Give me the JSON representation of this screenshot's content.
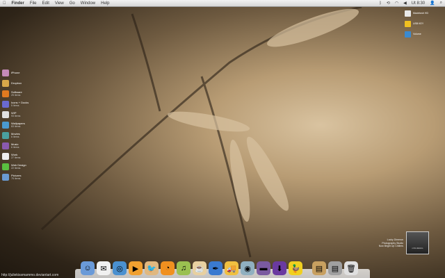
{
  "menubar": {
    "apple": "",
    "app": "Finder",
    "items": [
      "File",
      "Edit",
      "View",
      "Go",
      "Window",
      "Help"
    ],
    "status_icons": [
      "bluetooth-icon",
      "timemachine-icon",
      "wifi-icon",
      "volume-icon"
    ],
    "clock": "Ut 8:30"
  },
  "sidebar": [
    {
      "name": "iPhone",
      "count": "",
      "color": "#c48ab8"
    },
    {
      "name": "Dropbox",
      "count": "",
      "color": "#d9a84a"
    },
    {
      "name": "Software",
      "count": "25 Items",
      "color": "#e07a20"
    },
    {
      "name": "Icons + Docks",
      "count": "5 Items",
      "color": "#6a6ad0"
    },
    {
      "name": "WIP",
      "count": "93 Items",
      "color": "#e0e0e0"
    },
    {
      "name": "Wallpapers",
      "count": "83 Items",
      "color": "#4a9ad0"
    },
    {
      "name": "Movies",
      "count": "6 Items",
      "color": "#4aa0a0"
    },
    {
      "name": "Music",
      "count": "6 Items",
      "color": "#8a5ab0"
    },
    {
      "name": "Work",
      "count": "27 Items",
      "color": "#eeeeee"
    },
    {
      "name": "Web Design",
      "count": "22 Items",
      "color": "#5ac040"
    },
    {
      "name": "Pictures",
      "count": "75 Items",
      "color": "#6a9ad0"
    }
  ],
  "drives": [
    {
      "name": "Macintosh HD",
      "color": "#e8e8e8"
    },
    {
      "name": "USB KEY",
      "color": "#f0c020"
    },
    {
      "name": "Volume",
      "color": "#3a8ad0"
    }
  ],
  "dock": [
    {
      "name": "finder",
      "glyph": "☺",
      "color": "#6a9ad8"
    },
    {
      "name": "mail",
      "glyph": "✉",
      "color": "#f0f0f0"
    },
    {
      "name": "safari",
      "glyph": "◎",
      "color": "#4a90d0"
    },
    {
      "name": "ichat",
      "glyph": "▶",
      "color": "#f0a030"
    },
    {
      "name": "twitter",
      "glyph": "🐦",
      "color": "#e0b880"
    },
    {
      "name": "rss",
      "glyph": "◔",
      "color": "#f09020"
    },
    {
      "name": "itunes",
      "glyph": "♫",
      "color": "#9ac050"
    },
    {
      "name": "coffee",
      "glyph": "☕",
      "color": "#e8d0a0"
    },
    {
      "name": "feather",
      "glyph": "✒",
      "color": "#3a7ad0"
    },
    {
      "name": "transmit",
      "glyph": "🚚",
      "color": "#f0c040"
    },
    {
      "name": "time-machine",
      "glyph": "◉",
      "color": "#90b0c0"
    },
    {
      "name": "milka",
      "glyph": "▬",
      "color": "#7a5aa0"
    },
    {
      "name": "downloads",
      "glyph": "⬇",
      "color": "#6a3aa0"
    },
    {
      "name": "cyberduck",
      "glyph": "🦆",
      "color": "#f0d020"
    }
  ],
  "stacks": [
    {
      "name": "documents",
      "glyph": "▤",
      "color": "#c8a060"
    },
    {
      "name": "applications",
      "glyph": "▤",
      "color": "#a0a0a0"
    },
    {
      "name": "trash",
      "glyph": "🗑",
      "color": "#e0e0e0"
    }
  ],
  "widget": {
    "caption": "nOtLIkEtHis",
    "text": [
      "Lucky Dimeron",
      "Photography Studio",
      "Now Bright Up Chillers"
    ]
  },
  "statusbar": {
    "url": "http://juliekissmammo.deviantart.com"
  }
}
